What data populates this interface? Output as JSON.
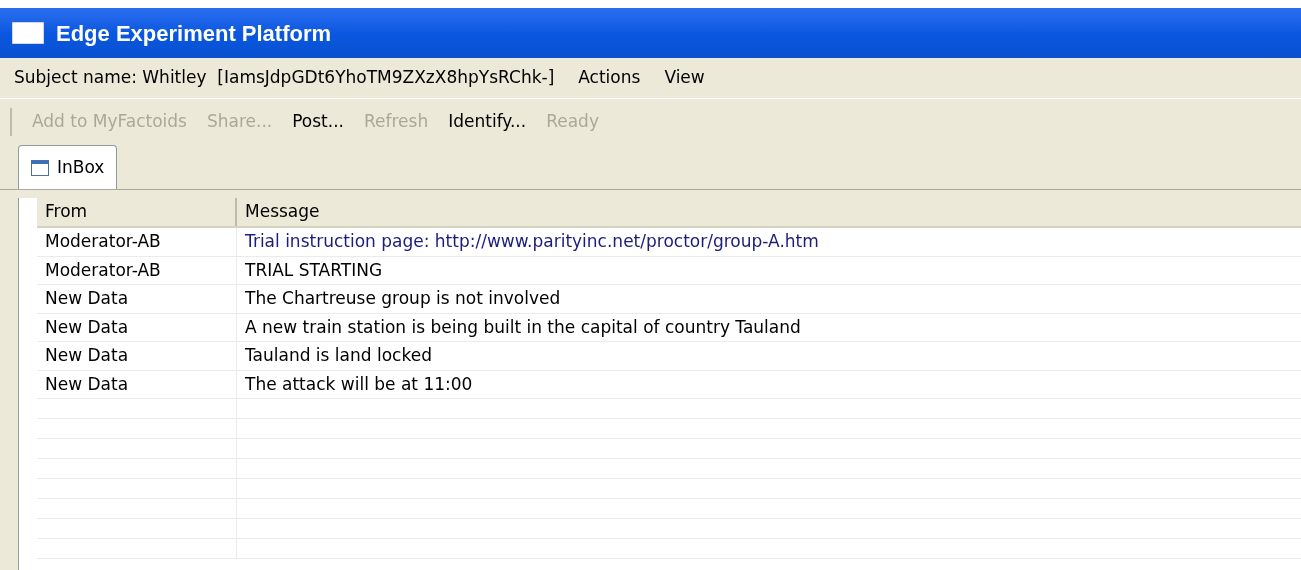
{
  "window": {
    "title": "Edge Experiment Platform"
  },
  "menu_bar": {
    "subject_label": "Subject name: Whitley  [IamsJdpGDt6YhoTM9ZXzX8hpYsRChk-]",
    "items": [
      "Actions",
      "View"
    ]
  },
  "toolbar": [
    {
      "label": "Add to MyFactoids",
      "disabled": true
    },
    {
      "label": "Share...",
      "disabled": true
    },
    {
      "label": "Post...",
      "disabled": false
    },
    {
      "label": "Refresh",
      "disabled": true
    },
    {
      "label": "Identify...",
      "disabled": false
    },
    {
      "label": "Ready",
      "disabled": true
    }
  ],
  "tabs": [
    {
      "label": "InBox",
      "selected": true
    }
  ],
  "table": {
    "columns": [
      "From",
      "Message"
    ],
    "rows": [
      {
        "from": "Moderator-AB",
        "message": "Trial instruction page: http://www.parityinc.net/proctor/group-A.htm",
        "kind": "link"
      },
      {
        "from": "Moderator-AB",
        "message": "TRIAL STARTING",
        "kind": "text"
      },
      {
        "from": "New Data",
        "message": "The Chartreuse group is not involved",
        "kind": "text"
      },
      {
        "from": "New Data",
        "message": "A new train station is being built in the capital of country Tauland",
        "kind": "text"
      },
      {
        "from": "New Data",
        "message": "Tauland is land locked",
        "kind": "text"
      },
      {
        "from": "New Data",
        "message": "The attack will be at 11:00",
        "kind": "text"
      }
    ]
  }
}
